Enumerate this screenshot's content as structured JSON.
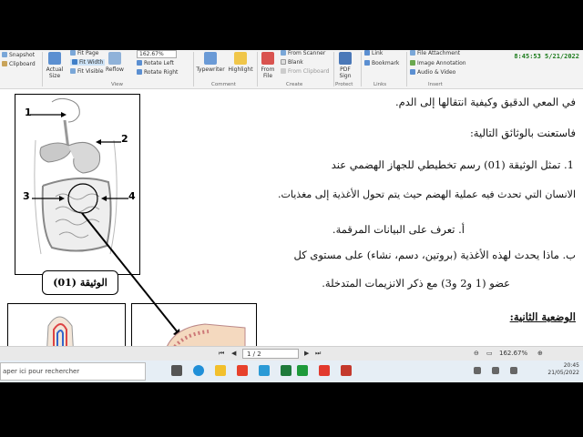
{
  "ribbon": {
    "snapshot": "Snapshot",
    "clipboard": "Clipboard",
    "actual_size": "Actual\nSize",
    "fit_page": "Fit Page",
    "fit_width": "Fit Width",
    "fit_visible": "Fit Visible",
    "zoom_value": "162.67%",
    "reflow": "Reflow",
    "rotate_left": "Rotate Left",
    "rotate_right": "Rotate Right",
    "view_group": "View",
    "typewriter": "Typewriter",
    "highlight": "Highlight",
    "comment_group": "Comment",
    "from_file": "From\nFile",
    "from_scanner": "From Scanner",
    "blank": "Blank",
    "from_clipboard": "From Clipboard",
    "create_group": "Create",
    "pdf_sign": "PDF\nSign",
    "protect_group": "Protect",
    "link": "Link",
    "bookmark": "Bookmark",
    "links_group": "Links",
    "file_attachment": "File Attachment",
    "image_annotation": "Image Annotation",
    "audio_video": "Audio & Video",
    "insert_group": "Insert",
    "clock": "8:45:53  5/21/2022"
  },
  "document": {
    "line1": "في المعي الدقيق وكيفية انتقالها إلى الدم.",
    "line2": "فاستعنت بالوثائق التالية:",
    "line3": "1.  تمثل الوثيقة (01) رسم تخطيطي للجهاز الهضمي عند",
    "line4": "الانسان التي تحدث فيه عملية الهضم حيث يتم تحول الأغذية إلى مغذيات.",
    "line5": "أ.  تعرف على البيانات المرقمة.",
    "line6": "ب.  ماذا يحدث لهذه الأغذية (بروتين، دسم، نشاء) على مستوى كل",
    "line7": "عضو  (1 و2 و3) مع ذكر الانزيمات المتدخلة.",
    "heading": "الوضعية الثانية:",
    "doc_label": "الوثيقة (01)",
    "numbers": [
      "1",
      "2",
      "3",
      "4"
    ]
  },
  "navbar": {
    "page_value": "1 / 2",
    "zoom": "162.67%"
  },
  "taskbar": {
    "search_placeholder": "aper ici pour rechercher",
    "time": "20:45",
    "date": "21/05/2022"
  },
  "colors": {
    "clock_green": "#1a7a1a",
    "doc_border": "#000000",
    "taskbar_bg": "#e6eef5"
  }
}
